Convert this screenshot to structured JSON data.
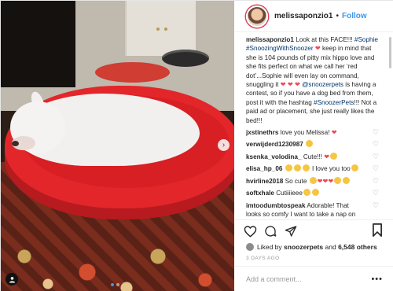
{
  "post": {
    "username": "melissaponzio1",
    "follow_label": "Follow",
    "caption": {
      "username": "melissaponzio1",
      "text_1": " Look at this FACE!!! ",
      "tag_1": "#Sophie",
      "text_2": " ",
      "tag_2": "#SnoozingWithSnoozer",
      "text_3": " keep in mind that she is 104 pounds of pitty mix hippo love and she fits perfect on what we call her ‘red dot’...Sophie will even lay on command, snuggling it ",
      "mention": "@snoozerpets",
      "text_4": " is having a contest, so if you have a dog bed from them, post it with the hashtag ",
      "tag_3": "#SnoozerPets",
      "text_5": "!!! Not a paid ad or placement, she just really likes the bed!!!"
    },
    "comments": [
      {
        "user": "jxstinethrs",
        "text": " love you Melissa! "
      },
      {
        "user": "verwijderd1230987",
        "text": " "
      },
      {
        "user": "ksenka_volodina_",
        "text": " Cute!!! "
      },
      {
        "user": "elisa_hp_06",
        "text": " I love you too"
      },
      {
        "user": "hvirline2018",
        "text": " So cute "
      },
      {
        "user": "softxhale",
        "text": " Cutiiiieee"
      },
      {
        "user": "imtoodumbtospeak",
        "text": " Adorable! That looks so comfy I want to take a nap on"
      }
    ],
    "likes": {
      "prefix": "Liked by ",
      "user": "snoozerpets",
      "middle": " and ",
      "count": "6,548 others"
    },
    "timestamp": "3 DAYS AGO",
    "comment_placeholder": "Add a comment...",
    "icons": {
      "like": "heart-icon",
      "comment": "comment-icon",
      "share": "share-icon",
      "save": "bookmark-icon",
      "more": "more-options-icon",
      "carousel_next": "chevron-right-icon",
      "tag": "user-tag-icon"
    },
    "colors": {
      "link": "#003569",
      "follow": "#3897f0",
      "heart": "#ed4956",
      "muted": "#999999"
    }
  }
}
